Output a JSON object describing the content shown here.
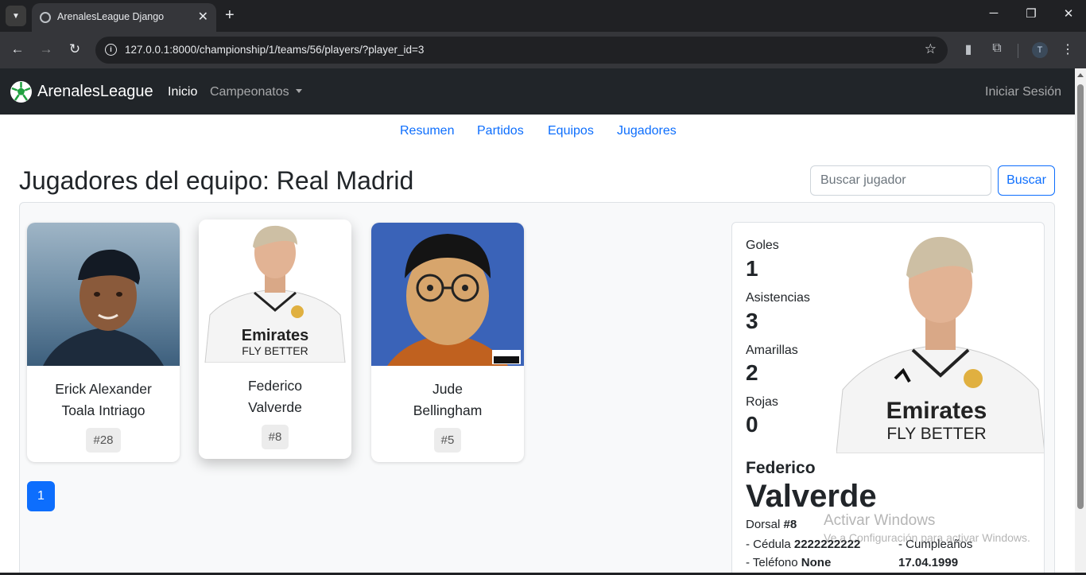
{
  "browser": {
    "tab_title": "ArenalesLeague Django",
    "url": "127.0.0.1:8000/championship/1/teams/56/players/?player_id=3",
    "profile_initial": "T"
  },
  "navbar": {
    "brand": "ArenalesLeague",
    "links": [
      "Inicio",
      "Campeonatos"
    ],
    "login": "Iniciar Sesión"
  },
  "subnav": [
    "Resumen",
    "Partidos",
    "Equipos",
    "Jugadores"
  ],
  "page": {
    "title": "Jugadores del equipo: Real Madrid",
    "search_placeholder": "Buscar jugador",
    "search_button": "Buscar"
  },
  "players": [
    {
      "first": "Erick Alexander",
      "last": "Toala Intriago",
      "number": "#28"
    },
    {
      "first": "Federico",
      "last": "Valverde",
      "number": "#8",
      "selected": true
    },
    {
      "first": "Jude",
      "last": "Bellingham",
      "number": "#5"
    }
  ],
  "pagination": {
    "current": "1"
  },
  "detail": {
    "stats": [
      {
        "label": "Goles",
        "value": "1"
      },
      {
        "label": "Asistencias",
        "value": "3"
      },
      {
        "label": "Amarillas",
        "value": "2"
      },
      {
        "label": "Rojas",
        "value": "0"
      }
    ],
    "first_name": "Federico",
    "last_name": "Valverde",
    "dorsal_label": "Dorsal",
    "dorsal_value": "#8",
    "cedula_label": "- Cédula",
    "cedula_value": "2222222222",
    "telefono_label": "- Teléfono",
    "telefono_value": "None",
    "cumple_label": "- Cumpleaños",
    "cumple_value": "17.04.1999"
  },
  "watermark": {
    "line1": "Activar Windows",
    "line2": "Ve a Configuración para activar Windows."
  },
  "colors": {
    "primary": "#0d6efd",
    "navbar": "#212529",
    "chrome": "#202124"
  }
}
